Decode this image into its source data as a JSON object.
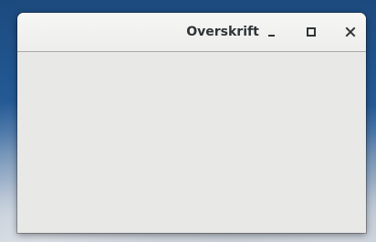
{
  "window": {
    "title": "Overskrift",
    "controls": {
      "minimize_icon": "minimize-icon",
      "maximize_icon": "maximize-icon",
      "close_icon": "close-icon"
    }
  },
  "colors": {
    "titlebar": "#f1f1f0",
    "content": "#e8e8e7",
    "title_text": "#2e3436",
    "desktop": "#21558f"
  }
}
